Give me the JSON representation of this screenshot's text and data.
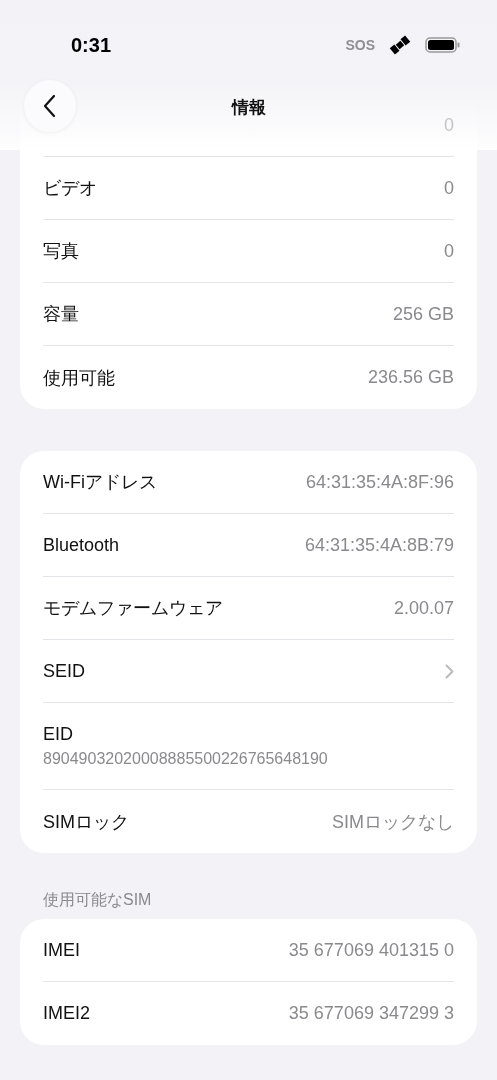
{
  "status_bar": {
    "time": "0:31",
    "carrier": "SOS"
  },
  "nav": {
    "title": "情報"
  },
  "sections": [
    {
      "rows": [
        {
          "kind": "faded",
          "value": "0"
        },
        {
          "kind": "value",
          "label": "ビデオ",
          "value": "0"
        },
        {
          "kind": "value",
          "label": "写真",
          "value": "0"
        },
        {
          "kind": "value",
          "label": "容量",
          "value": "256 GB"
        },
        {
          "kind": "value",
          "label": "使用可能",
          "value": "236.56 GB"
        }
      ]
    },
    {
      "rows": [
        {
          "kind": "value",
          "label": "Wi-Fiアドレス",
          "value": "64:31:35:4A:8F:96"
        },
        {
          "kind": "value",
          "label": "Bluetooth",
          "value": "64:31:35:4A:8B:79"
        },
        {
          "kind": "value",
          "label": "モデムファームウェア",
          "value": "2.00.07"
        },
        {
          "kind": "link",
          "label": "SEID"
        },
        {
          "kind": "stacked",
          "label": "EID",
          "value": "89049032020008885500226765648190"
        },
        {
          "kind": "value",
          "label": "SIMロック",
          "value": "SIMロックなし"
        }
      ]
    },
    {
      "header": "使用可能なSIM",
      "rows": [
        {
          "kind": "value",
          "label": "IMEI",
          "value": "35 677069 401315 0"
        },
        {
          "kind": "value",
          "label": "IMEI2",
          "value": "35 677069 347299 3"
        }
      ]
    }
  ]
}
